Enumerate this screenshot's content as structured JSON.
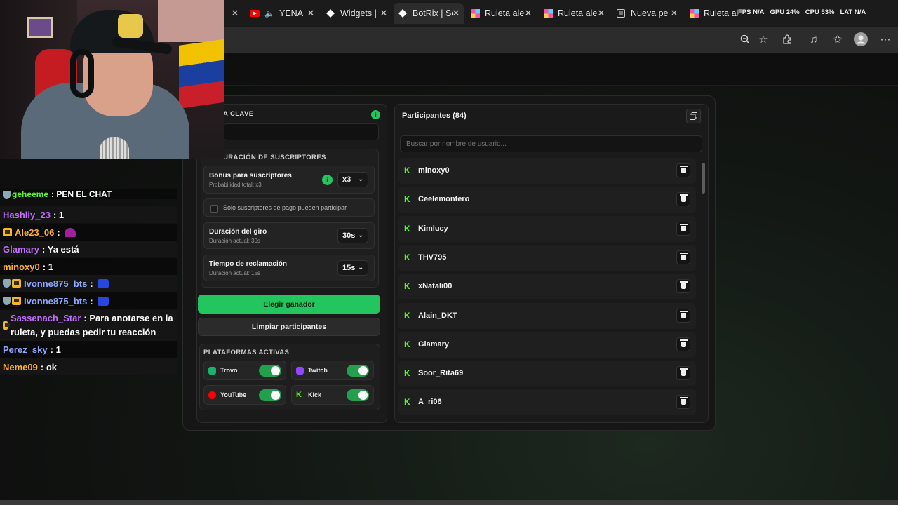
{
  "browser": {
    "tabs": [
      {
        "title": "YENA",
        "favicon": "youtube-icon",
        "icon_color": "#ff0000",
        "active": false
      },
      {
        "title": "Widgets |",
        "favicon": "diamond-icon",
        "icon_color": "#ffffff",
        "active": false
      },
      {
        "title": "BotRix | Sc",
        "favicon": "diamond-icon",
        "icon_color": "#ffffff",
        "active": true
      },
      {
        "title": "Ruleta ale",
        "favicon": "wheel-icon",
        "icon_color": "#ff4fa8",
        "active": false
      },
      {
        "title": "Ruleta ale",
        "favicon": "wheel-icon",
        "icon_color": "#ff4fa8",
        "active": false
      },
      {
        "title": "Nueva pe",
        "favicon": "page-icon",
        "icon_color": "#cccccc",
        "active": false
      },
      {
        "title": "Ruleta ale",
        "favicon": "wheel-icon",
        "icon_color": "#ff4fa8",
        "active": false
      }
    ],
    "stats": {
      "fps": "FPS N/A",
      "gpu": "GPU 24%",
      "cpu": "CPU 53%",
      "lat": "LAT N/A"
    },
    "toolbar_icons": [
      "zoom-icon",
      "star-icon",
      "extensions-icon",
      "music-icon",
      "favorites-icon",
      "profile-icon",
      "more-icon"
    ]
  },
  "chat": {
    "messages": [
      {
        "user": "geheeme",
        "text": ": PEN EL CHAT",
        "color": "#53fc18",
        "badges": [
          "shield"
        ],
        "emote": null,
        "partial": true
      },
      {
        "user": "Hashlly_23",
        "text": ": 1",
        "color": "#c26bff",
        "badges": [],
        "emote": null
      },
      {
        "user": "Ale23_06",
        "text": ":",
        "color": "#ffb020",
        "badges": [
          "crown"
        ],
        "emote": "hat"
      },
      {
        "user": "Glamary",
        "text": ": Ya está",
        "color": "#c26bff",
        "badges": [],
        "emote": null
      },
      {
        "user": "minoxy0",
        "text": ": 1",
        "color": "#ffb020",
        "badges": [],
        "emote": null
      },
      {
        "user": "Ivonne875_bts",
        "text": ":",
        "color": "#8fa8ff",
        "badges": [
          "shield",
          "crown"
        ],
        "emote": "blue"
      },
      {
        "user": "Ivonne875_bts",
        "text": ":",
        "color": "#8fa8ff",
        "badges": [
          "shield",
          "crown"
        ],
        "emote": "blue"
      },
      {
        "user": "Sassenach_Star",
        "text": ": Para anotarse en la ruleta, y puedas pedir tu reacción",
        "color": "#c26bff",
        "badges": [
          "crown"
        ],
        "emote": null
      },
      {
        "user": "Perez_sky",
        "text": ": 1",
        "color": "#8fa8ff",
        "badges": [],
        "emote": null
      },
      {
        "user": "Neme09",
        "text": ": ok",
        "color": "#ffb020",
        "badges": [],
        "emote": null
      }
    ]
  },
  "settings": {
    "key_label": "A CLAVE",
    "subs_title": "URACIÓN DE SUSCRIPTORES",
    "bonus": {
      "label": "Bonus para suscriptores",
      "sub": "Probabilidad total: x3",
      "value": "x3"
    },
    "paid_only": "Solo suscriptores de pago pueden participar",
    "duration": {
      "label": "Duración del giro",
      "sub": "Duración actual: 30s",
      "value": "30s"
    },
    "claim": {
      "label": "Tiempo de reclamación",
      "sub": "Duración actual: 15s",
      "value": "15s"
    },
    "pick_winner": "Elegir ganador",
    "clear": "Limpiar participantes",
    "platforms_title": "PLATAFORMAS ACTIVAS",
    "platforms": [
      {
        "name": "Trovo",
        "color": "#1bb36b",
        "enabled": true
      },
      {
        "name": "Twitch",
        "color": "#9146ff",
        "enabled": true
      },
      {
        "name": "YouTube",
        "color": "#ff0000",
        "enabled": true
      },
      {
        "name": "Kick",
        "color": "#53fc18",
        "enabled": true
      }
    ]
  },
  "participants": {
    "title": "Participantes (84)",
    "search_placeholder": "Buscar por nombre de usuario...",
    "list": [
      "minoxy0",
      "Ceelemontero",
      "Kimlucy",
      "THV795",
      "xNatali00",
      "Alain_DKT",
      "Glamary",
      "Soor_Rita69",
      "A_ri06"
    ]
  }
}
